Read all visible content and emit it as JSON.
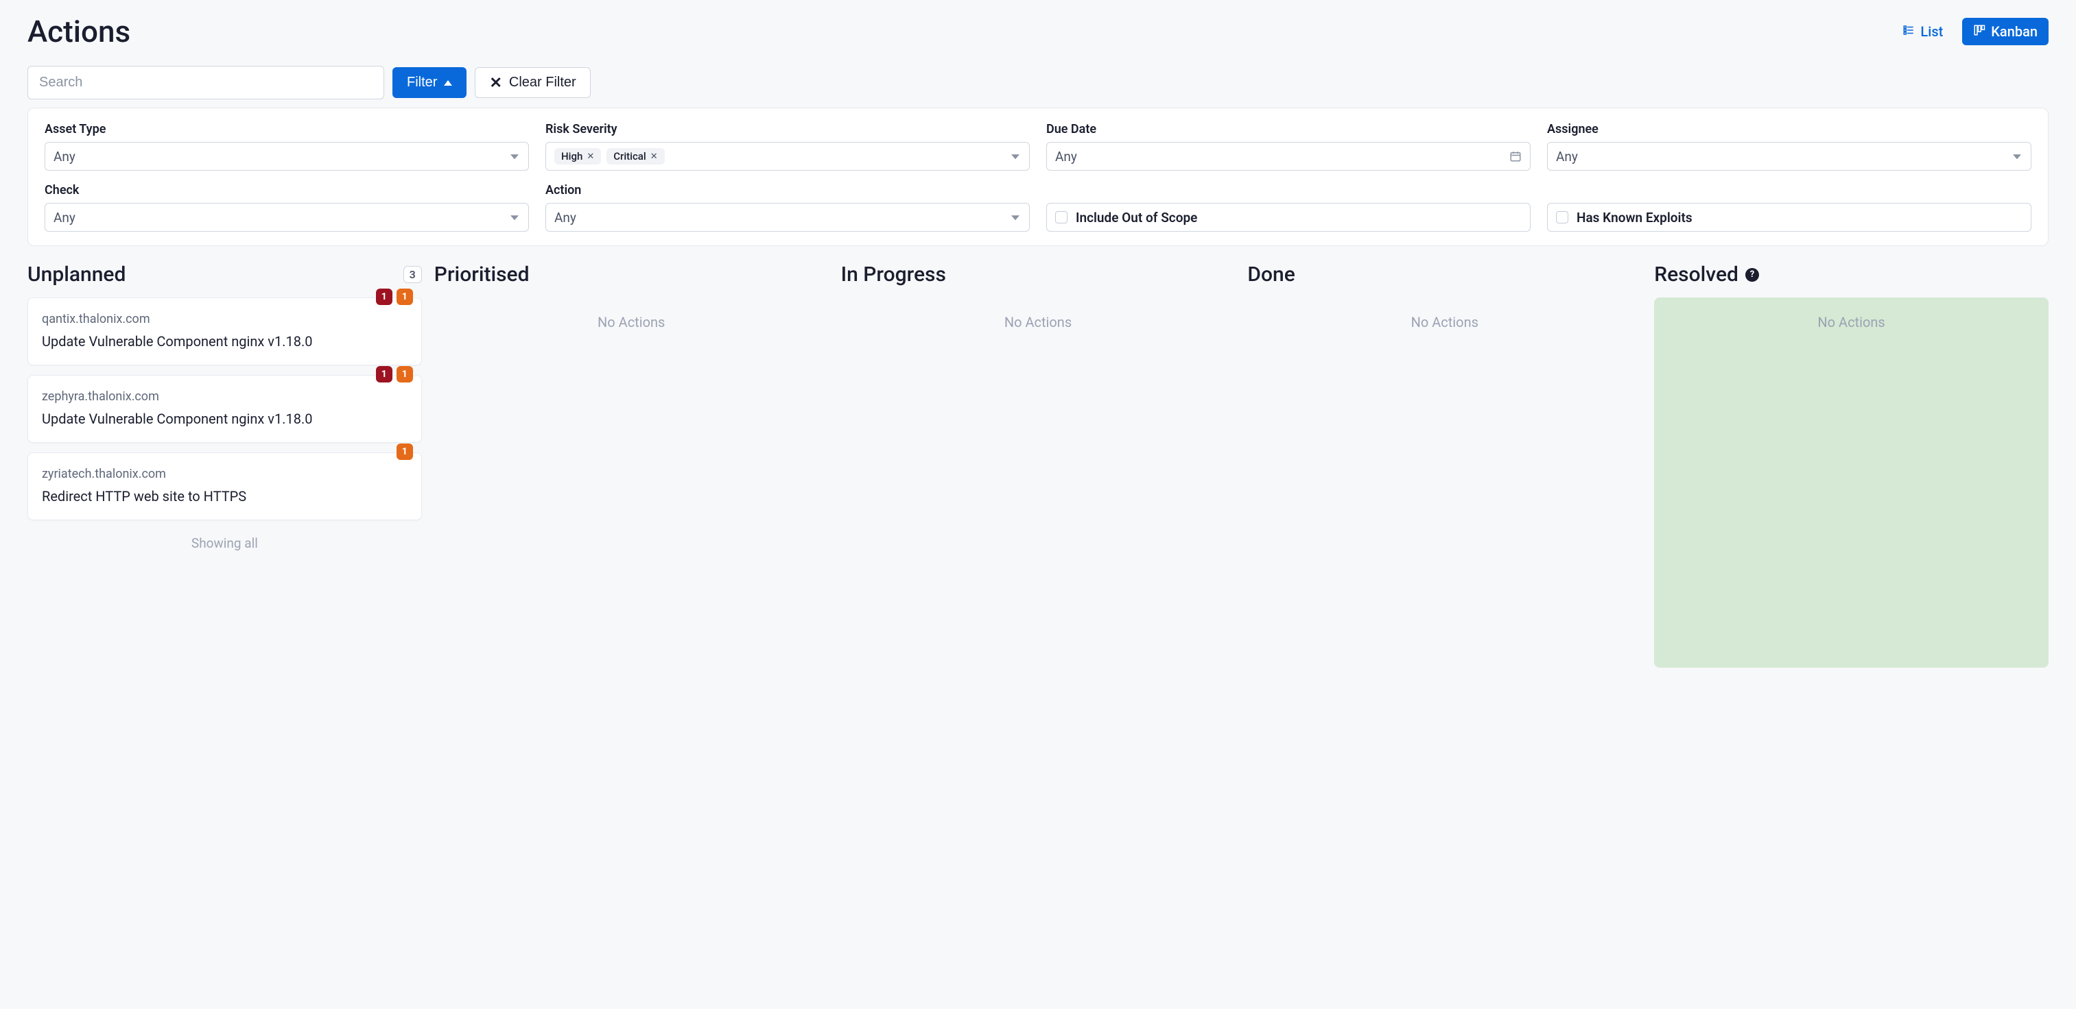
{
  "page": {
    "title": "Actions"
  },
  "viewToggle": {
    "list": "List",
    "kanban": "Kanban"
  },
  "filterBar": {
    "searchPlaceholder": "Search",
    "filterLabel": "Filter",
    "clearLabel": "Clear Filter"
  },
  "filters": {
    "assetType": {
      "label": "Asset Type",
      "value": "Any"
    },
    "riskSeverity": {
      "label": "Risk Severity",
      "tags": [
        "High",
        "Critical"
      ]
    },
    "dueDate": {
      "label": "Due Date",
      "value": "Any"
    },
    "assignee": {
      "label": "Assignee",
      "value": "Any"
    },
    "check": {
      "label": "Check",
      "value": "Any"
    },
    "action": {
      "label": "Action",
      "value": "Any"
    },
    "includeOutOfScope": {
      "label": "Include Out of Scope",
      "checked": false
    },
    "hasKnownExploits": {
      "label": "Has Known Exploits",
      "checked": false
    }
  },
  "columns": {
    "unplanned": {
      "title": "Unplanned",
      "count": "3",
      "showingAll": "Showing all",
      "cards": [
        {
          "host": "qantix.thalonix.com",
          "title": "Update Vulnerable Component nginx v1.18.0",
          "badges": [
            {
              "color": "red",
              "value": "1"
            },
            {
              "color": "orange",
              "value": "1"
            }
          ]
        },
        {
          "host": "zephyra.thalonix.com",
          "title": "Update Vulnerable Component nginx v1.18.0",
          "badges": [
            {
              "color": "red",
              "value": "1"
            },
            {
              "color": "orange",
              "value": "1"
            }
          ]
        },
        {
          "host": "zyriatech.thalonix.com",
          "title": "Redirect HTTP web site to HTTPS",
          "badges": [
            {
              "color": "orange",
              "value": "1"
            }
          ]
        }
      ]
    },
    "prioritised": {
      "title": "Prioritised",
      "empty": "No Actions"
    },
    "inProgress": {
      "title": "In Progress",
      "empty": "No Actions"
    },
    "done": {
      "title": "Done",
      "empty": "No Actions"
    },
    "resolved": {
      "title": "Resolved",
      "empty": "No Actions"
    }
  }
}
